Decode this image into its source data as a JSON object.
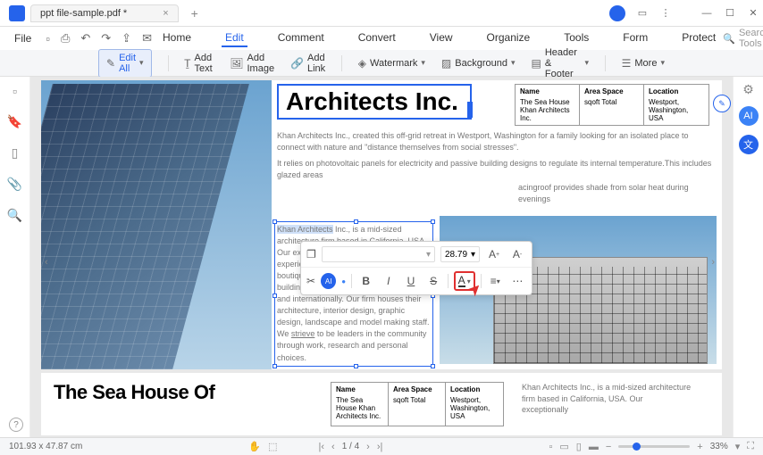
{
  "titlebar": {
    "tab_name": "ppt file-sample.pdf *"
  },
  "menubar": {
    "file": "File",
    "items": [
      "Home",
      "Edit",
      "Comment",
      "Convert",
      "View",
      "Organize",
      "Tools",
      "Form",
      "Protect"
    ],
    "active_index": 1,
    "search_placeholder": "Search Tools"
  },
  "toolbar": {
    "edit_all": "Edit All",
    "add_text": "Add Text",
    "add_image": "Add Image",
    "add_link": "Add Link",
    "watermark": "Watermark",
    "background": "Background",
    "header_footer": "Header & Footer",
    "more": "More"
  },
  "float_toolbar": {
    "font_size": "28.79"
  },
  "doc": {
    "title": "Architects Inc.",
    "info_headers": [
      "Name",
      "Area Space",
      "Location"
    ],
    "info_values": [
      "The Sea House Khan Architects Inc.",
      "sqoft Total",
      "Westport, Washington, USA"
    ],
    "para1": "Khan Architects Inc., created this off-grid retreat in Westport, Washington for a family looking for an isolated place to connect with nature and \"distance themselves from social stresses\".",
    "para2": "It relies on photovoltaic panels for electricity and passive building designs to regulate its internal temperature.This includes glazed areas",
    "para3_frag": "acingroof provides shade from solar heat during evenings",
    "block_highlight": "Khan Architects",
    "block_rest": " Inc., is a mid-sized architecture firm based in California, USA. Our exceptionally talented and experienced staff work on projects from boutique interiors to large institutional buildings and airport complexes, locally and internationally. Our firm houses their architecture, interior design, graphic design, landscape and model making staff. We ",
    "block_underline": "strieve",
    "block_end": " to be leaders in the community through work, research and personal choices.",
    "page2_title": "The Sea House Of",
    "page2_text": "Khan Architects Inc., is a mid-sized architecture firm based in California, USA. Our exceptionally"
  },
  "statusbar": {
    "dimensions": "101.93 x 47.87 cm",
    "page": "1 / 4",
    "zoom": "33%"
  }
}
